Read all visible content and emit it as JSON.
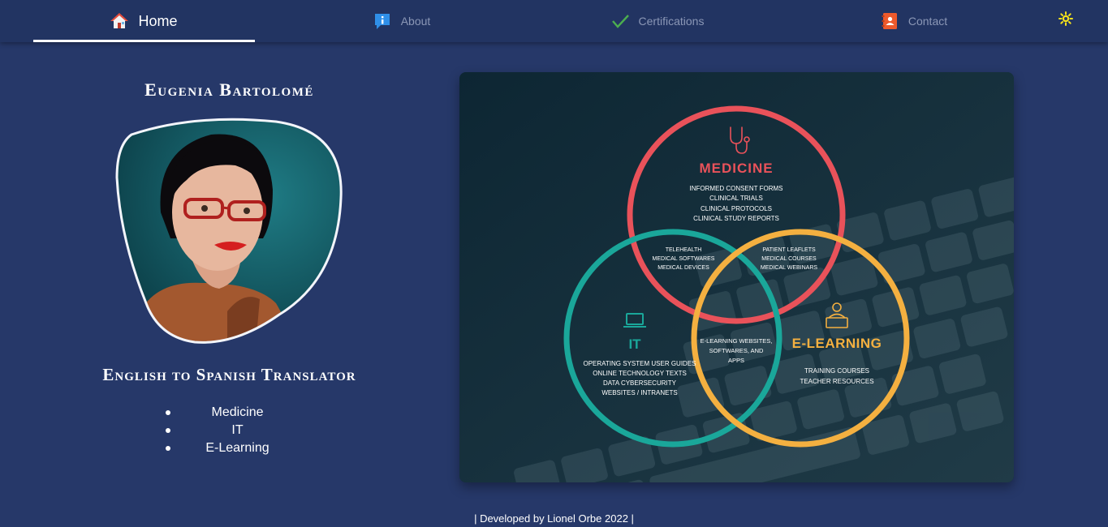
{
  "nav": {
    "items": [
      {
        "label": "Home",
        "icon": "house-icon",
        "active": true
      },
      {
        "label": "About",
        "icon": "info-icon",
        "active": false
      },
      {
        "label": "Certifications",
        "icon": "check-icon",
        "active": false
      },
      {
        "label": "Contact",
        "icon": "contact-book-icon",
        "active": false
      }
    ],
    "theme_toggle_icon": "sun-icon"
  },
  "profile": {
    "name": "Eugenia Bartolomé",
    "role": "English to Spanish Translator",
    "specialties": [
      "Medicine",
      "IT",
      "E-Learning"
    ]
  },
  "venn": {
    "medicine": {
      "title": "MEDICINE",
      "icon": "stethoscope-icon",
      "color": "#e9525a",
      "items": [
        "INFORMED CONSENT FORMS",
        "CLINICAL TRIALS",
        "CLINICAL PROTOCOLS",
        "CLINICAL STUDY REPORTS"
      ]
    },
    "it": {
      "title": "IT",
      "icon": "laptop-icon",
      "color": "#1aa79a",
      "items": [
        "OPERATING SYSTEM USER GUIDES",
        "ONLINE TECHNOLOGY TEXTS",
        "DATA CYBERSECURITY",
        "WEBSITES / INTRANETS"
      ]
    },
    "elearning": {
      "title": "E-LEARNING",
      "icon": "online-teacher-icon",
      "color": "#f4b040",
      "items": [
        "TRAINING COURSES",
        "TEACHER RESOURCES"
      ]
    },
    "medicine_it": [
      "TELEHEALTH",
      "MEDICAL SOFTWARES",
      "MEDICAL DEVICES"
    ],
    "medicine_elearning": [
      "PATIENT LEAFLETS",
      "MEDICAL COURSES",
      "MEDICAL WEBINARS"
    ],
    "it_elearning": [
      "E-LEARNING WEBSITES,",
      "SOFTWARES, AND",
      "APPS"
    ]
  },
  "footer": {
    "text": "| Developed by Lionel Orbe 2022 |"
  },
  "colors": {
    "page_bg": "#263869",
    "nav_bg": "#223462",
    "nav_inactive_text": "#8b97b6",
    "card_bg": "#0e2a3a"
  }
}
